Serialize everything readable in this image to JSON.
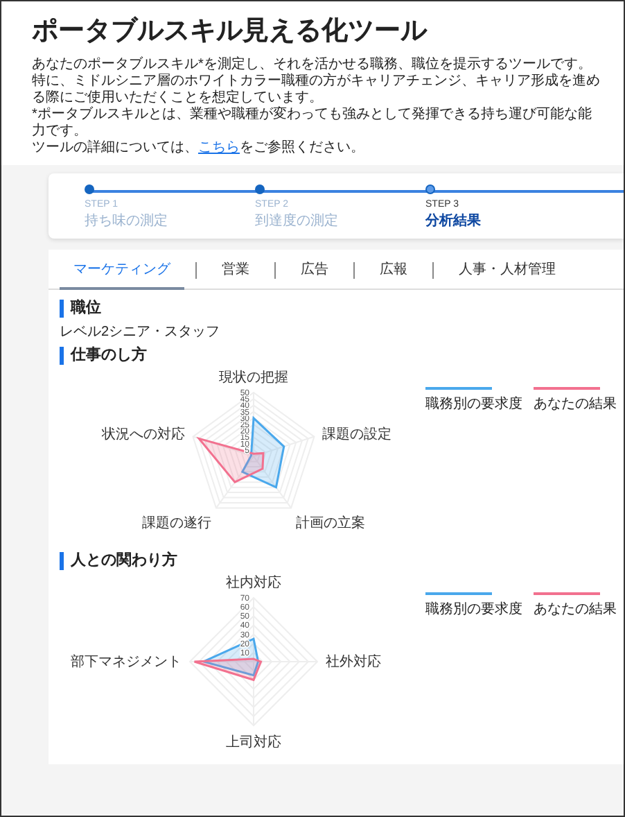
{
  "title": "ポータブルスキル見える化ツール",
  "intro": [
    "あなたのポータブルスキル*を測定し、それを活かせる職務、職位を提示するツールです。",
    "特に、ミドルシニア層のホワイトカラー職種の方がキャリアチェンジ、キャリア形成を進める際にご使用いただくことを想定しています。",
    "*ポータブルスキルとは、業種や職種が変わっても強みとして発揮できる持ち運び可能な能力です。"
  ],
  "intro_link_line": {
    "before": "ツールの詳細については、",
    "link": "こちら",
    "after": "をご参照ください。"
  },
  "steps": [
    {
      "step": "STEP 1",
      "label": "持ち味の測定",
      "selected": false
    },
    {
      "step": "STEP 2",
      "label": "到達度の測定",
      "selected": false
    },
    {
      "step": "STEP 3",
      "label": "分析結果",
      "selected": true
    }
  ],
  "tabs": [
    {
      "label": "マーケティング",
      "selected": true
    },
    {
      "label": "営業",
      "selected": false
    },
    {
      "label": "広告",
      "selected": false
    },
    {
      "label": "広報",
      "selected": false
    },
    {
      "label": "人事・人材管理",
      "selected": false
    }
  ],
  "position": {
    "heading": "職位",
    "value": "レベル2シニア・スタッフ"
  },
  "sections": [
    {
      "heading": "仕事のし方",
      "chart_data": {
        "type": "radar",
        "categories": [
          "現状の把握",
          "課題の設定",
          "計画の立案",
          "課題の遂行",
          "状況への対応"
        ],
        "ylim": [
          0,
          50
        ],
        "yticks": [
          5,
          10,
          15,
          20,
          25,
          30,
          35,
          40,
          45,
          50
        ],
        "series": [
          {
            "name": "職務別の要求度",
            "color": "#4aa8ec",
            "values": [
              30,
              25,
              30,
              15,
              2
            ]
          },
          {
            "name": "あなたの結果",
            "color": "#f2718f",
            "values": [
              2,
              8,
              12,
              25,
              45
            ]
          }
        ]
      }
    },
    {
      "heading": "人との関わり方",
      "chart_data": {
        "type": "radar",
        "categories": [
          "社内対応",
          "社外対応",
          "上司対応",
          "部下マネジメント"
        ],
        "ylim": [
          0,
          70
        ],
        "yticks": [
          10,
          20,
          30,
          40,
          50,
          60,
          70
        ],
        "series": [
          {
            "name": "職務別の要求度",
            "color": "#4aa8ec",
            "values": [
              25,
              5,
              15,
              55
            ]
          },
          {
            "name": "あなたの結果",
            "color": "#f2718f",
            "values": [
              3,
              8,
              20,
              65
            ]
          }
        ]
      }
    }
  ]
}
